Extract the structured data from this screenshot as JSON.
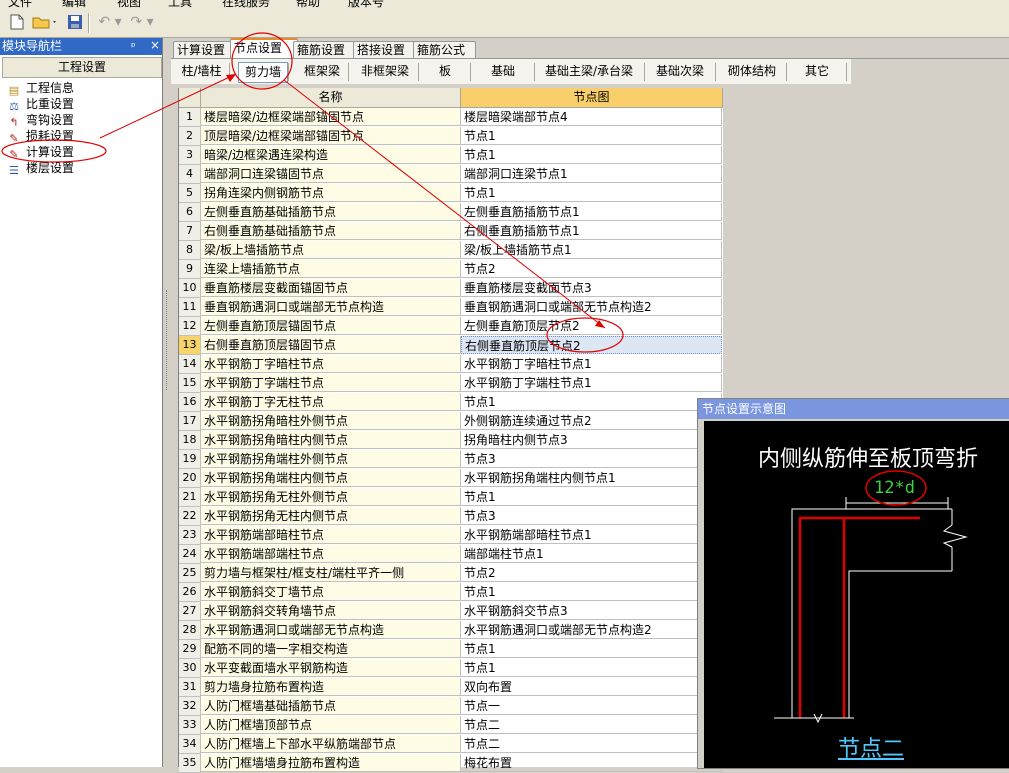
{
  "menu": [
    "文件",
    "编辑",
    "视图",
    "工具",
    "在线服务",
    "帮助",
    "版本号"
  ],
  "nav": {
    "title": "模块导航栏",
    "pin": "ᵖ",
    "close": "×",
    "section": "工程设置",
    "items": [
      {
        "label": "工程信息",
        "icon": "project-info-icon"
      },
      {
        "label": "比重设置",
        "icon": "weight-icon"
      },
      {
        "label": "弯钩设置",
        "icon": "hook-icon"
      },
      {
        "label": "损耗设置",
        "icon": "loss-icon"
      },
      {
        "label": "计算设置",
        "icon": "calc-settings-icon"
      },
      {
        "label": "楼层设置",
        "icon": "floor-icon"
      }
    ]
  },
  "tabs": [
    "计算设置",
    "节点设置",
    "箍筋设置",
    "搭接设置",
    "箍筋公式"
  ],
  "active_tab": 1,
  "subtabs": [
    "柱/墙柱",
    "剪力墙",
    "框架梁",
    "非框架梁",
    "板",
    "基础",
    "基础主梁/承台梁",
    "基础次梁",
    "砌体结构",
    "其它"
  ],
  "active_subtab": 1,
  "grid": {
    "headers": {
      "name": "名称",
      "node": "节点图"
    },
    "selected_row": 13,
    "rows": [
      {
        "no": "1",
        "name": "楼层暗梁/边框梁端部锚固节点",
        "node": "楼层暗梁端部节点4"
      },
      {
        "no": "2",
        "name": "顶层暗梁/边框梁端部锚固节点",
        "node": "节点1"
      },
      {
        "no": "3",
        "name": "暗梁/边框梁遇连梁构造",
        "node": "节点1"
      },
      {
        "no": "4",
        "name": "端部洞口连梁锚固节点",
        "node": "端部洞口连梁节点1"
      },
      {
        "no": "5",
        "name": "拐角连梁内侧钢筋节点",
        "node": "节点1"
      },
      {
        "no": "6",
        "name": "左侧垂直筋基础插筋节点",
        "node": "左侧垂直筋插筋节点1"
      },
      {
        "no": "7",
        "name": "右侧垂直筋基础插筋节点",
        "node": "右侧垂直筋插筋节点1"
      },
      {
        "no": "8",
        "name": "梁/板上墙插筋节点",
        "node": "梁/板上墙插筋节点1"
      },
      {
        "no": "9",
        "name": "连梁上墙插筋节点",
        "node": "节点2"
      },
      {
        "no": "10",
        "name": "垂直筋楼层变截面锚固节点",
        "node": "垂直筋楼层变截面节点3"
      },
      {
        "no": "11",
        "name": "垂直钢筋遇洞口或端部无节点构造",
        "node": "垂直钢筋遇洞口或端部无节点构造2"
      },
      {
        "no": "12",
        "name": "左侧垂直筋顶层锚固节点",
        "node": "左侧垂直筋顶层节点2"
      },
      {
        "no": "13",
        "name": "右侧垂直筋顶层锚固节点",
        "node": "右侧垂直筋顶层节点2"
      },
      {
        "no": "14",
        "name": "水平钢筋丁字暗柱节点",
        "node": "水平钢筋丁字暗柱节点1"
      },
      {
        "no": "15",
        "name": "水平钢筋丁字端柱节点",
        "node": "水平钢筋丁字端柱节点1"
      },
      {
        "no": "16",
        "name": "水平钢筋丁字无柱节点",
        "node": "节点1"
      },
      {
        "no": "17",
        "name": "水平钢筋拐角暗柱外侧节点",
        "node": "外侧钢筋连续通过节点2"
      },
      {
        "no": "18",
        "name": "水平钢筋拐角暗柱内侧节点",
        "node": "拐角暗柱内侧节点3"
      },
      {
        "no": "19",
        "name": "水平钢筋拐角端柱外侧节点",
        "node": "节点3"
      },
      {
        "no": "20",
        "name": "水平钢筋拐角端柱内侧节点",
        "node": "水平钢筋拐角端柱内侧节点1"
      },
      {
        "no": "21",
        "name": "水平钢筋拐角无柱外侧节点",
        "node": "节点1"
      },
      {
        "no": "22",
        "name": "水平钢筋拐角无柱内侧节点",
        "node": "节点3"
      },
      {
        "no": "23",
        "name": "水平钢筋端部暗柱节点",
        "node": "水平钢筋端部暗柱节点1"
      },
      {
        "no": "24",
        "name": "水平钢筋端部端柱节点",
        "node": "端部端柱节点1"
      },
      {
        "no": "25",
        "name": "剪力墙与框架柱/框支柱/端柱平齐一侧",
        "node": "节点2"
      },
      {
        "no": "26",
        "name": "水平钢筋斜交丁墙节点",
        "node": "节点1"
      },
      {
        "no": "27",
        "name": "水平钢筋斜交转角墙节点",
        "node": "水平钢筋斜交节点3"
      },
      {
        "no": "28",
        "name": "水平钢筋遇洞口或端部无节点构造",
        "node": "水平钢筋遇洞口或端部无节点构造2"
      },
      {
        "no": "29",
        "name": "配筋不同的墙一字相交构造",
        "node": "节点1"
      },
      {
        "no": "30",
        "name": "水平变截面墙水平钢筋构造",
        "node": "节点1"
      },
      {
        "no": "31",
        "name": "剪力墙身拉筋布置构造",
        "node": "双向布置"
      },
      {
        "no": "32",
        "name": "人防门框墙基础插筋节点",
        "node": "节点一"
      },
      {
        "no": "33",
        "name": "人防门框墙顶部节点",
        "node": "节点二"
      },
      {
        "no": "34",
        "name": "人防门框墙上下部水平纵筋端部节点",
        "node": "节点二"
      },
      {
        "no": "35",
        "name": "人防门框墙墙身拉筋布置构造",
        "node": "梅花布置"
      }
    ]
  },
  "preview": {
    "title": "节点设置示意图",
    "heading": "内侧纵筋伸至板顶弯折",
    "dimension": "12*d",
    "node_label": "节点二"
  },
  "colors": {
    "annotation": "#e00000",
    "accent": "#e68b2c",
    "selected": "#316ac5"
  }
}
